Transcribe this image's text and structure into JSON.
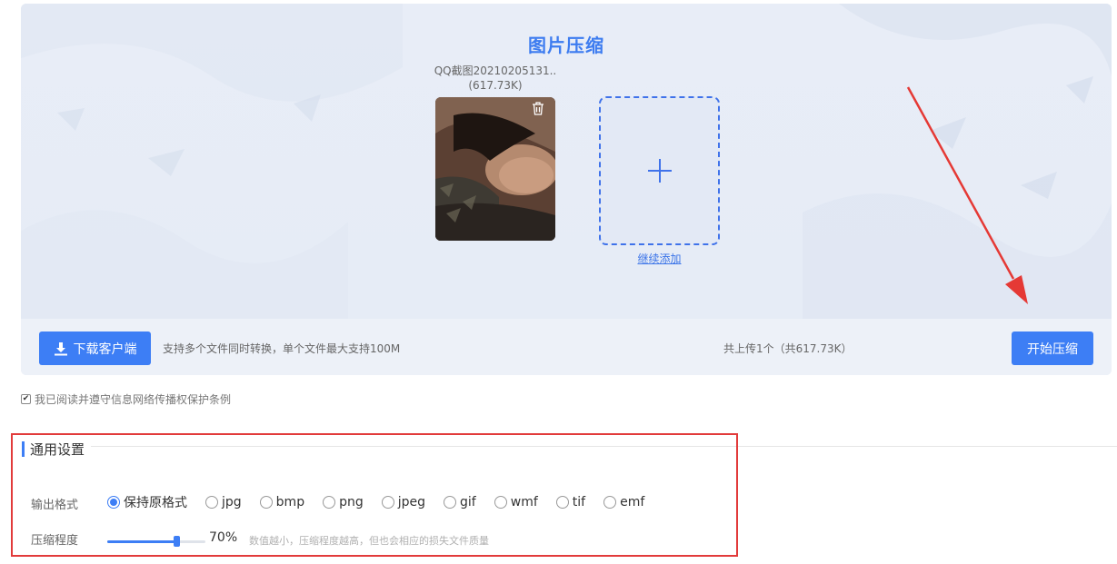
{
  "panel": {
    "title": "图片压缩"
  },
  "file": {
    "name": "QQ截图20210205131..",
    "size": "(617.73K)"
  },
  "add_more": {
    "link_label": "继续添加"
  },
  "bottom_bar": {
    "download_label": "下载客户端",
    "hint": "支持多个文件同时转换，单个文件最大支持100M",
    "upload_count": "共上传1个（共617.73K）",
    "start_label": "开始压缩"
  },
  "agreement": {
    "checked": true,
    "text": "我已阅读并遵守信息网络传播权保护条例"
  },
  "settings": {
    "title": "通用设置",
    "format_label": "输出格式",
    "formats": [
      {
        "label": "保持原格式",
        "checked": true
      },
      {
        "label": "jpg",
        "checked": false
      },
      {
        "label": "bmp",
        "checked": false
      },
      {
        "label": "png",
        "checked": false
      },
      {
        "label": "jpeg",
        "checked": false
      },
      {
        "label": "gif",
        "checked": false
      },
      {
        "label": "wmf",
        "checked": false
      },
      {
        "label": "tif",
        "checked": false
      },
      {
        "label": "emf",
        "checked": false
      }
    ],
    "compression_label": "压缩程度",
    "compression_value": "70%",
    "compression_level": 0.7,
    "compression_hint": "数值越小，压缩程度越高，但也会相应的损失文件质量"
  },
  "colors": {
    "accent": "#3d7ef5",
    "highlight_border": "#e23b3b",
    "annotation_arrow": "#e53935"
  },
  "icons": {
    "delete": "trash-icon",
    "add": "plus-icon",
    "download": "download-icon"
  }
}
